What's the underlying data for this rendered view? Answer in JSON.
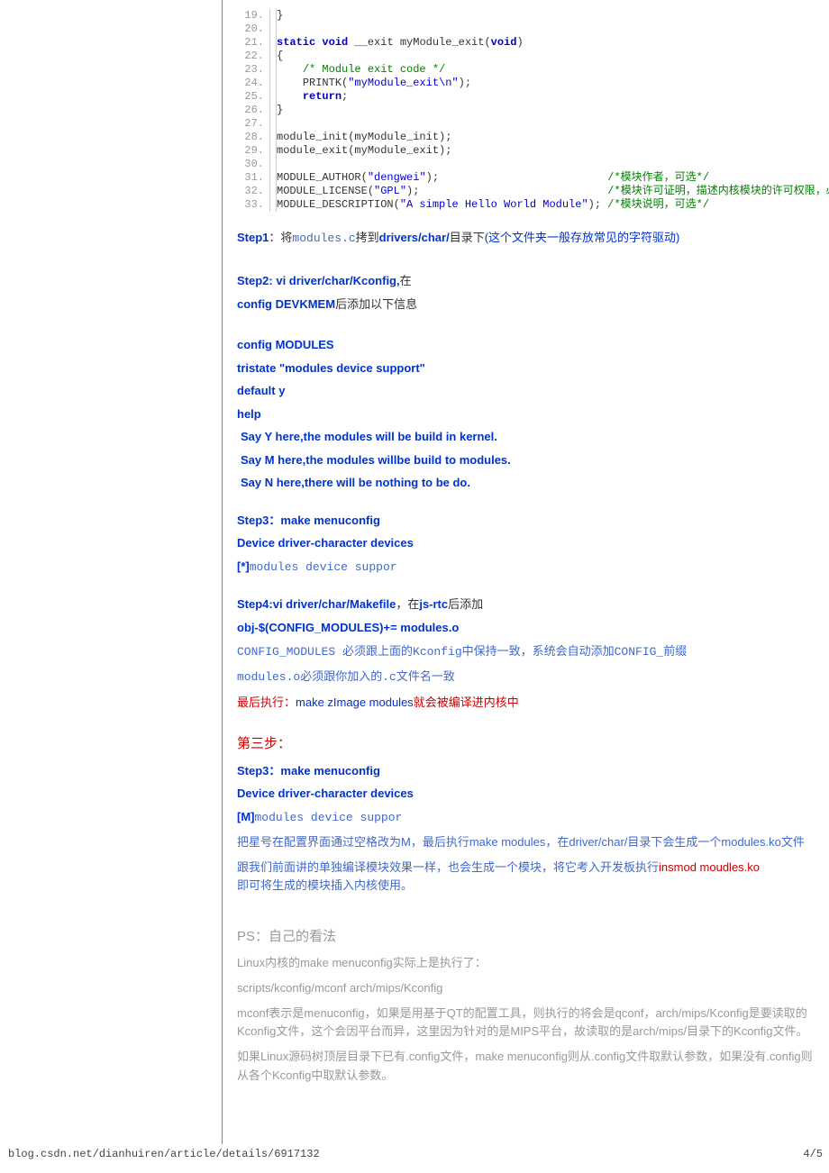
{
  "code": {
    "lines": [
      {
        "n": "19.",
        "t": "}"
      },
      {
        "n": "20.",
        "t": ""
      },
      {
        "n": "21.",
        "pre": "",
        "kw1": "static",
        "mid1": " ",
        "kw2": "void",
        "mid2": " __exit myModule_exit(",
        "kw3": "void",
        "aft": ")"
      },
      {
        "n": "22.",
        "t": "{"
      },
      {
        "n": "23.",
        "ind": "    ",
        "cm": "/* Module exit code */"
      },
      {
        "n": "24.",
        "ind": "    ",
        "a": "PRINTK(",
        "s": "\"myModule_exit\\n\"",
        "b": ");"
      },
      {
        "n": "25.",
        "ind": "    ",
        "kw1": "return",
        "aft": ";"
      },
      {
        "n": "26.",
        "t": "}"
      },
      {
        "n": "27.",
        "t": ""
      },
      {
        "n": "28.",
        "t": "module_init(myModule_init);"
      },
      {
        "n": "29.",
        "t": "module_exit(myModule_exit);"
      },
      {
        "n": "30.",
        "t": ""
      },
      {
        "n": "31.",
        "a": "MODULE_AUTHOR(",
        "s": "\"dengwei\"",
        "b": ");",
        "pad": "                          ",
        "cm": "/*模块作者，可选*/"
      },
      {
        "n": "32.",
        "a": "MODULE_LICENSE(",
        "s": "\"GPL\"",
        "b": ");",
        "pad": "                             ",
        "cm": "/*模块许可证明，描述内核模块的许可权限，必须*/"
      },
      {
        "n": "33.",
        "a": "MODULE_DESCRIPTION(",
        "s": "\"A simple Hello World Module\"",
        "b": "); ",
        "cm": "/*模块说明，可选*/"
      }
    ]
  },
  "step1": {
    "label": "Step1",
    "mid": "：将",
    "m1": "modules.c",
    "m2": "拷到",
    "blue": "drivers/char/",
    "m3": "目录下",
    "m4": "(这个文件夹一般存放常见的字符驱动)"
  },
  "step2": {
    "line1a": "Step2: vi driver/char/Kconfig,",
    "line1b": "在",
    "line2a": "config DEVKMEM",
    "line2b": "后添加以下信息",
    "cfg1": "config MODULES",
    "cfg2": "tristate \"modules device support\"",
    "cfg3": "default y",
    "cfg4": "help",
    "cfg5": "Say Y here,the modules will be build in kernel.",
    "cfg6": "Say M here,the modules willbe build to modules.",
    "cfg7": "Say N here,there will be nothing to be do."
  },
  "step3a": {
    "l1": "Step3：make menuconfig",
    "l2": "Device driver-character devices",
    "star": "[*]",
    "l3": "modules device suppor"
  },
  "step4": {
    "l1a": "Step4:vi driver/char/Makefile",
    "l1b": "，在",
    "l1c": "js-rtc",
    "l1d": "后添加",
    "l2": "obj-$(CONFIG_MODULES)+= modules.o",
    "p1": "CONFIG_MODULES 必须跟上面的Kconfig中保持一致，系统会自动添加CONFIG_前缀",
    "p2": "modules.o必须跟你加入的.c文件名一致",
    "p3a": "最后执行：",
    "p3b": "make zImage modules",
    "p3c": "就会被编译进内核中"
  },
  "third": {
    "title": "第三步：",
    "l1": "Step3：make menuconfig",
    "l2": "Device driver-character devices",
    "mtag": "[M]",
    "l3": "modules device suppor",
    "p1": "把星号在配置界面通过空格改为M，最后执行make modules，在driver/char/目录下会生成一个modules.ko文件",
    "p2a": "跟我们前面讲的单独编译模块效果一样，也会生成一个模块，将它考入开发板执行",
    "p2b": "insmod moudles.ko",
    "p2c": "即可将生成的模块插入内核使用。"
  },
  "ps": {
    "title": "PS：自己的看法",
    "p1": "Linux内核的make menuconfig实际上是执行了：",
    "p2": "scripts/kconfig/mconf      arch/mips/Kconfig",
    "p3": "mconf表示是menuconfig，如果是用基于QT的配置工具，则执行的将会是qconf，arch/mips/Kconfig是要读取的Kconfig文件，这个会因平台而异，这里因为针对的是MIPS平台，故读取的是arch/mips/目录下的Kconfig文件。",
    "p4": "如果Linux源码树顶层目录下已有.config文件，make menuconfig则从.config文件取默认参数，如果没有.config则从各个Kconfig中取默认参数。"
  },
  "footer": {
    "left": "blog.csdn.net/dianhuiren/article/details/6917132",
    "right": "4/5"
  }
}
